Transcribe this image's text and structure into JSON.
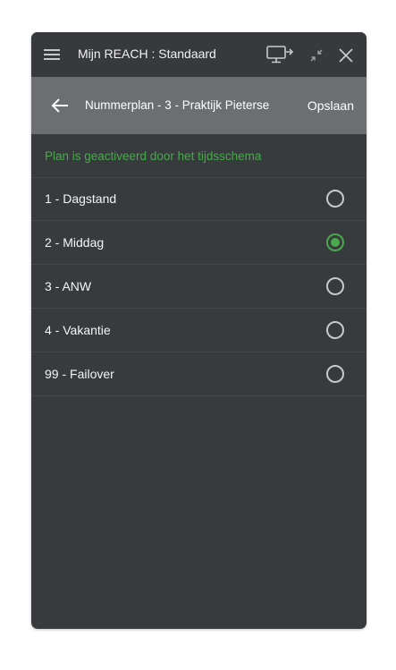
{
  "window": {
    "title": "Mijn REACH : Standaard"
  },
  "header": {
    "title": "Nummerplan - 3 - Praktijk Pieterse",
    "save_label": "Opslaan"
  },
  "status": {
    "text": "Plan is geactiveerd door het tijdsschema"
  },
  "plans": [
    {
      "label": "1 - Dagstand",
      "selected": false
    },
    {
      "label": "2 - Middag",
      "selected": true
    },
    {
      "label": "3 - ANW",
      "selected": false
    },
    {
      "label": "4 - Vakantie",
      "selected": false
    },
    {
      "label": "99 - Failover",
      "selected": false
    }
  ],
  "colors": {
    "background": "#373b3e",
    "subheader": "#6b6f72",
    "accent_green": "#49a94b",
    "text": "#f4f4f4"
  },
  "icons": {
    "menu": "hamburger-menu-icon",
    "screen_share": "monitor-arrow-icon",
    "minimize": "collapse-arrows-icon",
    "close": "close-icon",
    "back": "arrow-left-icon"
  }
}
